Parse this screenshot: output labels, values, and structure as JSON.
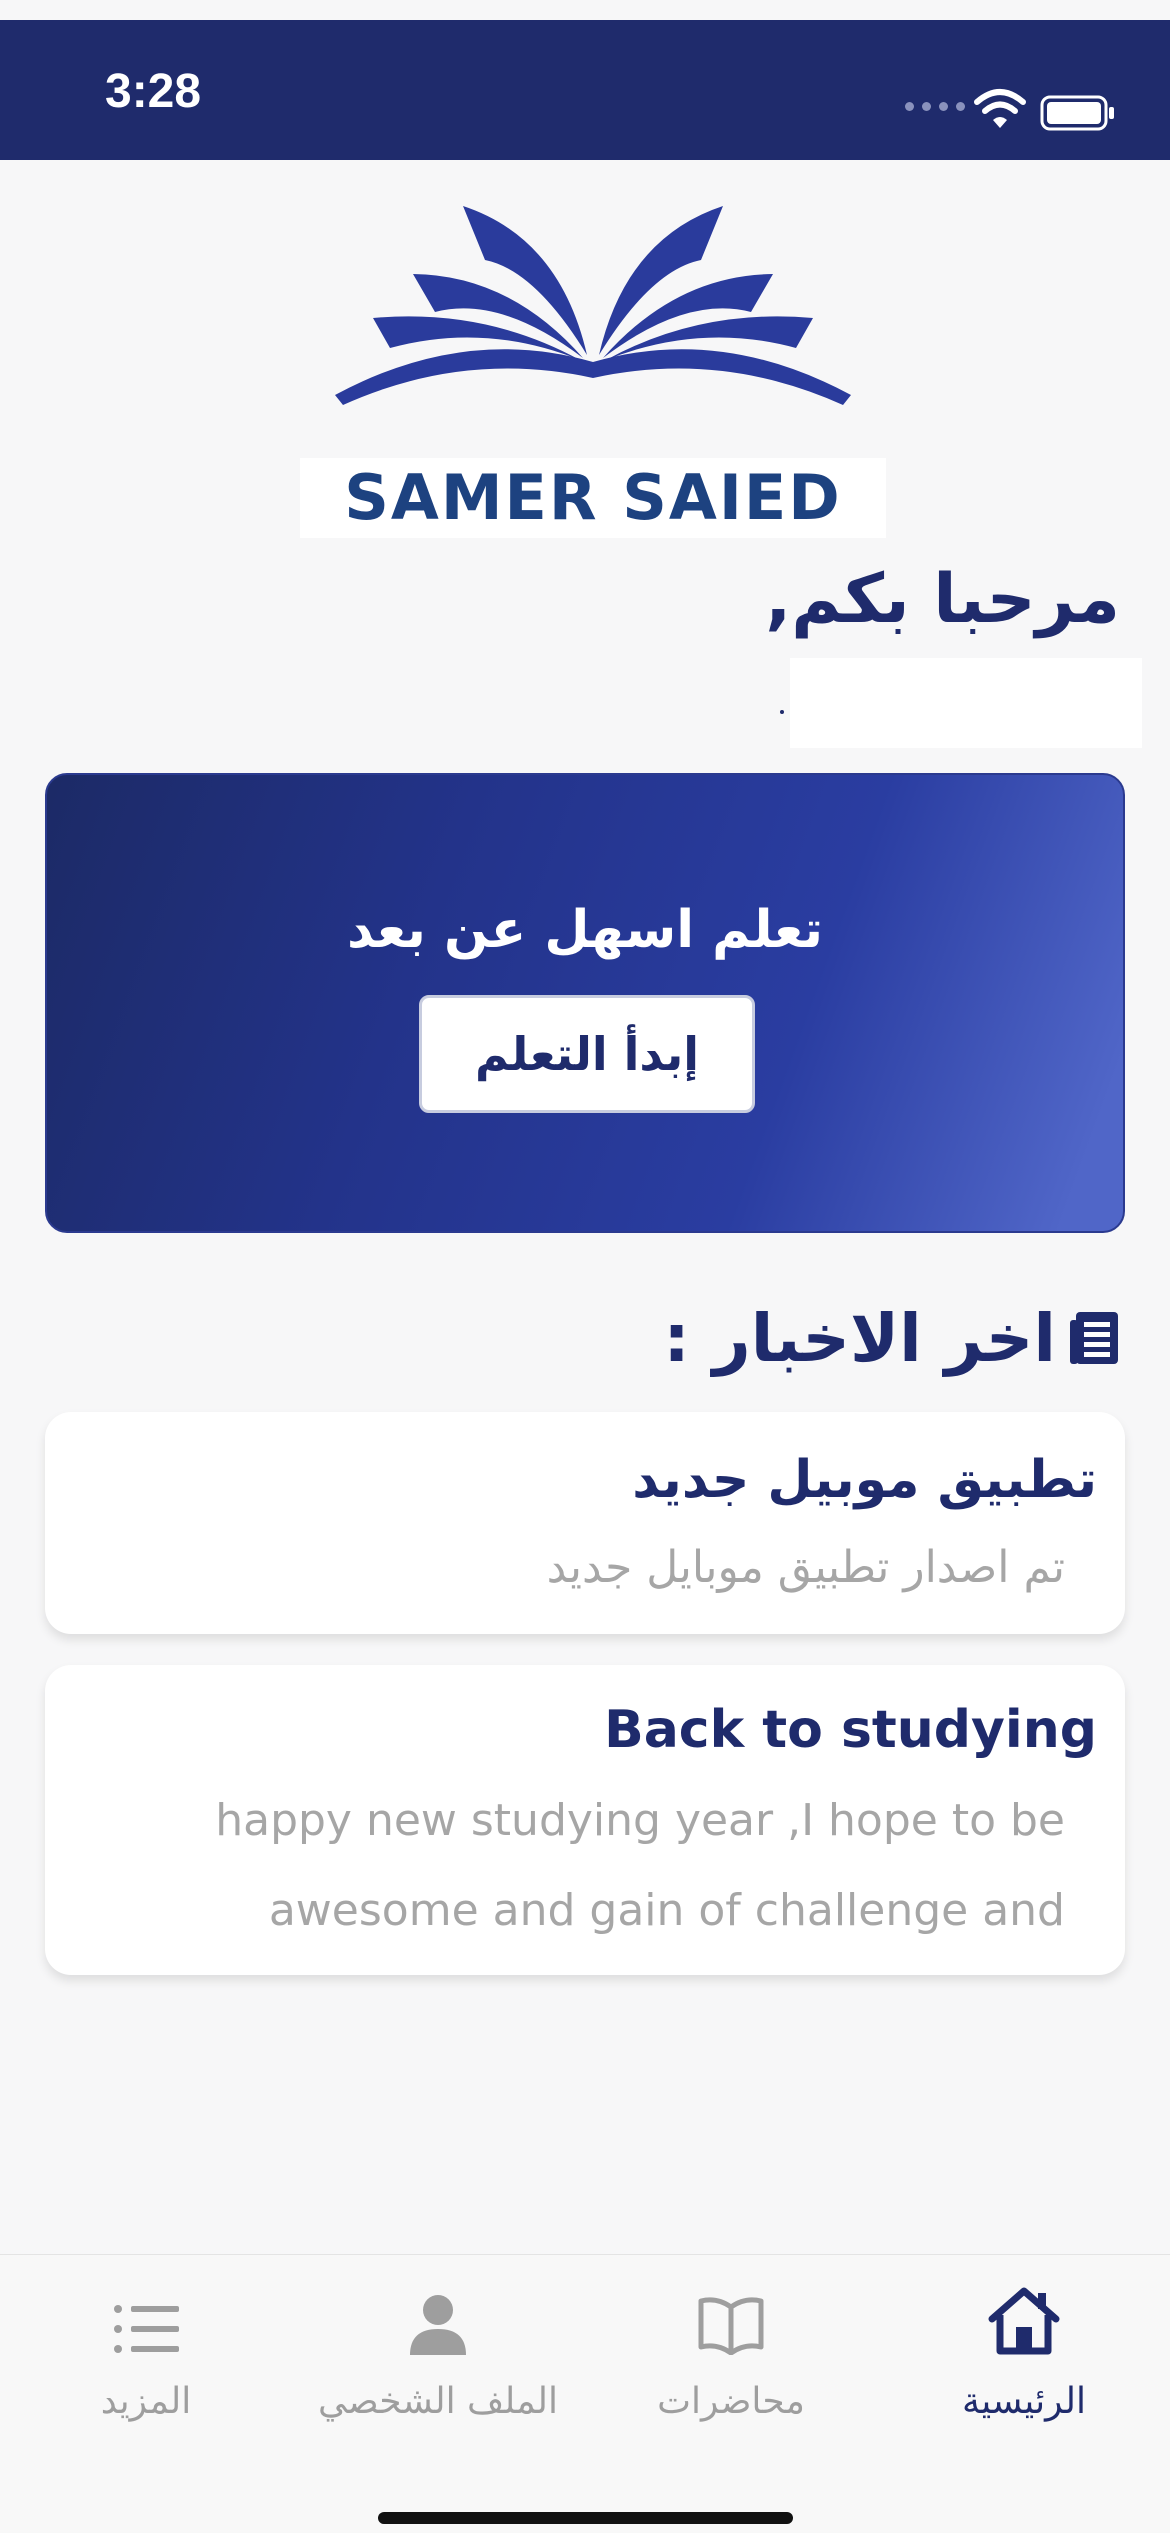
{
  "status_bar": {
    "time": "3:28"
  },
  "logo": {
    "text": "SAMER SAIED"
  },
  "greeting": {
    "welcome": "مرحبا بكم,"
  },
  "hero": {
    "title": "تعلم اسهل عن بعد",
    "button_label": "إبدأ التعلم"
  },
  "news": {
    "heading": "اخر الاخبار :",
    "items": [
      {
        "title": "تطبيق موبيل جديد",
        "body_lines": [
          "تم اصدار تطبيق موبايل جديد"
        ]
      },
      {
        "title": "Back to studying",
        "body_lines": [
          "happy new studying year ,I hope to be",
          "awesome and gain of challenge and"
        ]
      }
    ]
  },
  "tabs": [
    {
      "label": "الرئيسية",
      "icon": "home-icon",
      "active": true
    },
    {
      "label": "محاضرات",
      "icon": "book-icon",
      "active": false
    },
    {
      "label": "الملف الشخصي",
      "icon": "person-icon",
      "active": false
    },
    {
      "label": "المزيد",
      "icon": "list-icon",
      "active": false
    }
  ],
  "colors": {
    "primary": "#1f2b6c",
    "accent": "#2a3da1",
    "muted_text": "#a6a6a6",
    "inactive_tab": "#9e9e9e"
  }
}
